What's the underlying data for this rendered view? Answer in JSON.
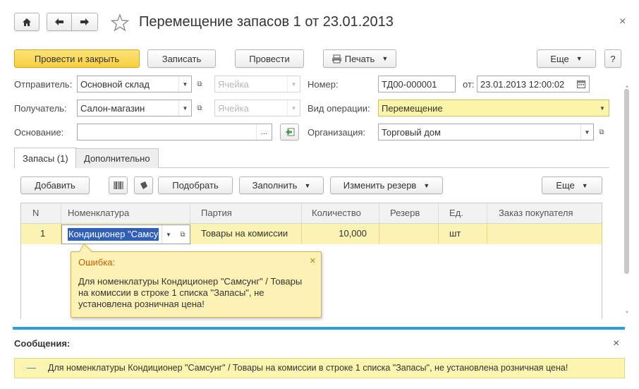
{
  "header": {
    "title": "Перемещение запасов 1 от 23.01.2013",
    "close_glyph": "×"
  },
  "toolbar": {
    "post_close": "Провести и закрыть",
    "save": "Записать",
    "post": "Провести",
    "print": "Печать",
    "more": "Еще",
    "help": "?"
  },
  "form": {
    "sender_label": "Отправитель:",
    "sender_value": "Основной склад",
    "sender_cell_placeholder": "Ячейка",
    "recipient_label": "Получатель:",
    "recipient_value": "Салон-магазин",
    "recipient_cell_placeholder": "Ячейка",
    "basis_label": "Основание:",
    "basis_value": "",
    "basis_ellipsis": "...",
    "number_label": "Номер:",
    "number_value": "ТД00-000001",
    "date_label": "от:",
    "date_value": "23.01.2013 12:00:02",
    "op_label": "Вид операции:",
    "op_value": "Перемещение",
    "org_label": "Организация:",
    "org_value": "Торговый дом"
  },
  "tabs": [
    {
      "label": "Запасы (1)",
      "active": true
    },
    {
      "label": "Дополнительно",
      "active": false
    }
  ],
  "table_toolbar": {
    "add": "Добавить",
    "pick": "Подобрать",
    "fill": "Заполнить",
    "change_reserve": "Изменить резерв",
    "more": "Еще"
  },
  "table": {
    "columns": [
      "N",
      "Номенклатура",
      "Партия",
      "Количество",
      "Резерв",
      "Ед.",
      "Заказ покупателя"
    ],
    "rows": [
      {
        "n": "1",
        "item": "Кондиционер \"Самсу",
        "batch": "Товары на комиссии",
        "qty": "10,000",
        "reserve": "",
        "unit": "шт",
        "order": ""
      }
    ]
  },
  "tooltip": {
    "title": "Ошибка:",
    "text": "Для номенклатуры Кондиционер \"Самсунг\" / Товары на комиссии в строке 1 списка \"Запасы\", не установлена розничная цена!"
  },
  "messages": {
    "title": "Сообщения:",
    "text": "Для номенклатуры Кондиционер \"Самсунг\" / Товары на комиссии в строке 1 списка \"Запасы\", не установлена розничная цена!",
    "dash": "—"
  },
  "colors": {
    "accent_yellow": "#f7cf3d",
    "row_selected": "#fbf3b4",
    "tooltip_bg": "#fdf1b5",
    "messages_bar": "#2a9fd8",
    "error_title": "#cc5a00"
  }
}
